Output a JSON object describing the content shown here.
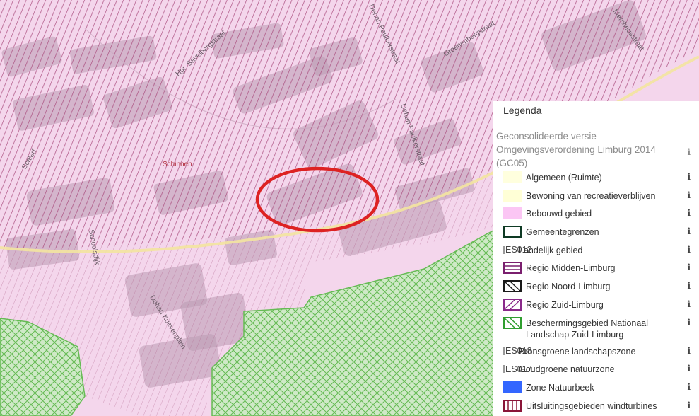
{
  "map": {
    "streets": [
      "Hgr. Savelbergstraat",
      "Dehan Paulkerstraat",
      "Groenenbergstraat",
      "Mercheusstraat",
      "Dehan Paulkerstraat",
      "Scalerf",
      "Schoolsdijk",
      "Dehan Kuevenplein"
    ],
    "places": [
      "Schinnen"
    ],
    "colors": {
      "base": "#f4d6ec",
      "hatch": "#a8487a",
      "road": "#f3e4a0",
      "green_fill": "#cfe9c7",
      "green_hatch": "#66bb55",
      "marker": "#dd2222"
    }
  },
  "legend": {
    "title": "Legenda",
    "layer_title": "Geconsolideerde versie Omgevingsverordening Limburg 2014 (GC05)",
    "info_glyph": "i",
    "items": [
      {
        "label": "Algemeen (Ruimte)",
        "swatch": "solid",
        "color": "#ffffde"
      },
      {
        "label": "Bewoning van recreatieverblijven",
        "swatch": "solid",
        "color": "#ffffd6"
      },
      {
        "label": "Bebouwd gebied",
        "swatch": "solid",
        "color": "#fbc6f4"
      },
      {
        "label": "Gemeentegrenzen",
        "swatch": "outline",
        "color": "#0e3a24"
      },
      {
        "label": "Landelijk gebied",
        "swatch": "image",
        "alt": "ES012"
      },
      {
        "label": "Regio Midden-Limburg",
        "swatch": "hlines",
        "color": "#7a1f6e"
      },
      {
        "label": "Regio Noord-Limburg",
        "swatch": "diag-back",
        "color": "#1a1a1a"
      },
      {
        "label": "Regio Zuid-Limburg",
        "swatch": "diag-fwd",
        "color": "#8a2a8a"
      },
      {
        "label": "Beschermingsgebied Nationaal Landschap Zuid-Limburg",
        "swatch": "diag-green",
        "color": "#2f9e2f"
      },
      {
        "label": "Bronsgroene landschapszone",
        "swatch": "image",
        "alt": "ES018"
      },
      {
        "label": "Goudgroene natuurzone",
        "swatch": "image",
        "alt": "ES017"
      },
      {
        "label": "Zone Natuurbeek",
        "swatch": "solid",
        "color": "#3366ff"
      },
      {
        "label": "Uitsluitingsgebieden windturbines",
        "swatch": "vlines",
        "color": "#8a1538"
      }
    ]
  }
}
